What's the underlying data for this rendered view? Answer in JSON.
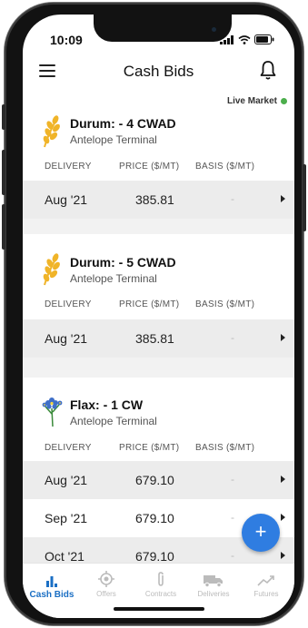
{
  "status_bar": {
    "time": "10:09"
  },
  "header": {
    "title": "Cash Bids"
  },
  "live_market": "Live Market",
  "columns": {
    "delivery": "DELIVERY",
    "price": "PRICE ($/MT)",
    "basis": "BASIS ($/MT)"
  },
  "bids": [
    {
      "crop": "Durum: - 4 CWAD",
      "location": "Antelope Terminal",
      "icon": "wheat-icon",
      "rows": [
        {
          "delivery": "Aug '21",
          "price": "385.81",
          "basis": "-"
        }
      ]
    },
    {
      "crop": "Durum: - 5 CWAD",
      "location": "Antelope Terminal",
      "icon": "wheat-icon",
      "rows": [
        {
          "delivery": "Aug '21",
          "price": "385.81",
          "basis": "-"
        }
      ]
    },
    {
      "crop": "Flax: - 1 CW",
      "location": "Antelope Terminal",
      "icon": "flax-flower-icon",
      "rows": [
        {
          "delivery": "Aug '21",
          "price": "679.10",
          "basis": "-"
        },
        {
          "delivery": "Sep '21",
          "price": "679.10",
          "basis": "-"
        },
        {
          "delivery": "Oct '21",
          "price": "679.10",
          "basis": "-"
        }
      ]
    }
  ],
  "fab": {
    "label": "+"
  },
  "tabs": [
    {
      "label": "Cash Bids",
      "icon": "bar-chart-icon",
      "active": true
    },
    {
      "label": "Offers",
      "icon": "target-icon",
      "active": false
    },
    {
      "label": "Contracts",
      "icon": "paperclip-icon",
      "active": false
    },
    {
      "label": "Deliveries",
      "icon": "truck-icon",
      "active": false
    },
    {
      "label": "Futures",
      "icon": "trend-icon",
      "active": false
    }
  ],
  "colors": {
    "accent": "#1b6fc4",
    "fab": "#2f7de1",
    "live": "#4cae4c",
    "wheat": "#f0b429"
  }
}
